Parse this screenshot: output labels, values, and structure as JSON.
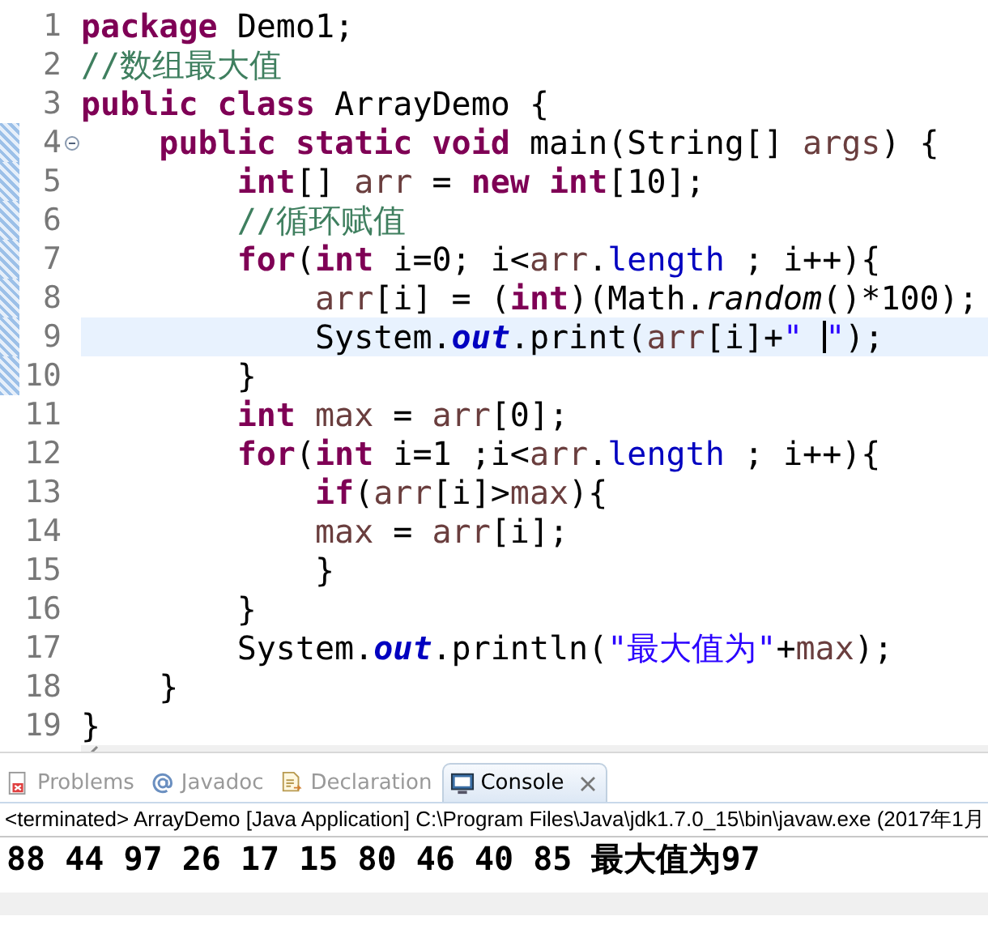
{
  "editor": {
    "lines": [
      {
        "number": "1",
        "selected": false,
        "fold": false,
        "marked": false,
        "tokens": [
          {
            "text": "package ",
            "kind": "keyword"
          },
          {
            "text": "Demo1;",
            "kind": "plain"
          }
        ]
      },
      {
        "number": "2",
        "selected": false,
        "fold": false,
        "marked": false,
        "tokens": [
          {
            "text": "//数组最大值",
            "kind": "comment"
          }
        ]
      },
      {
        "number": "3",
        "selected": false,
        "fold": false,
        "marked": false,
        "tokens": [
          {
            "text": "public class ",
            "kind": "keyword"
          },
          {
            "text": "ArrayDemo {",
            "kind": "plain"
          }
        ]
      },
      {
        "number": "4",
        "selected": false,
        "fold": true,
        "marked": true,
        "tokens": [
          {
            "text": "    public static void ",
            "kind": "keyword"
          },
          {
            "text": "main(String[] ",
            "kind": "plain"
          },
          {
            "text": "args",
            "kind": "variable"
          },
          {
            "text": ") {",
            "kind": "plain"
          }
        ]
      },
      {
        "number": "5",
        "selected": false,
        "fold": false,
        "marked": true,
        "tokens": [
          {
            "text": "        int",
            "kind": "keyword"
          },
          {
            "text": "[] ",
            "kind": "plain"
          },
          {
            "text": "arr",
            "kind": "variable"
          },
          {
            "text": " = ",
            "kind": "plain"
          },
          {
            "text": "new int",
            "kind": "keyword"
          },
          {
            "text": "[10];",
            "kind": "plain"
          }
        ]
      },
      {
        "number": "6",
        "selected": false,
        "fold": false,
        "marked": true,
        "tokens": [
          {
            "text": "        //循环赋值",
            "kind": "comment"
          }
        ]
      },
      {
        "number": "7",
        "selected": false,
        "fold": false,
        "marked": true,
        "tokens": [
          {
            "text": "        for",
            "kind": "keyword"
          },
          {
            "text": "(",
            "kind": "plain"
          },
          {
            "text": "int",
            "kind": "keyword"
          },
          {
            "text": " i=0; i<",
            "kind": "plain"
          },
          {
            "text": "arr",
            "kind": "variable"
          },
          {
            "text": ".",
            "kind": "plain"
          },
          {
            "text": "length",
            "kind": "field"
          },
          {
            "text": " ; i++){",
            "kind": "plain"
          }
        ]
      },
      {
        "number": "8",
        "selected": false,
        "fold": false,
        "marked": true,
        "tokens": [
          {
            "text": "            arr",
            "kind": "variable"
          },
          {
            "text": "[i] = (",
            "kind": "plain"
          },
          {
            "text": "int",
            "kind": "keyword"
          },
          {
            "text": ")(Math.",
            "kind": "plain"
          },
          {
            "text": "random",
            "kind": "static_method"
          },
          {
            "text": "()*100);",
            "kind": "plain"
          }
        ]
      },
      {
        "number": "9",
        "selected": true,
        "fold": false,
        "marked": true,
        "tokens": [
          {
            "text": "            System.",
            "kind": "plain"
          },
          {
            "text": "out",
            "kind": "static_field"
          },
          {
            "text": ".print(",
            "kind": "plain"
          },
          {
            "text": "arr",
            "kind": "variable"
          },
          {
            "text": "[i]+",
            "kind": "plain"
          },
          {
            "text": "\" ",
            "kind": "string",
            "caret_after": true
          },
          {
            "text": "\"",
            "kind": "string"
          },
          {
            "text": ");",
            "kind": "plain"
          }
        ]
      },
      {
        "number": "10",
        "selected": false,
        "fold": false,
        "marked": true,
        "tokens": [
          {
            "text": "        }",
            "kind": "plain"
          }
        ]
      },
      {
        "number": "11",
        "selected": false,
        "fold": false,
        "marked": false,
        "tokens": [
          {
            "text": "        int ",
            "kind": "keyword"
          },
          {
            "text": "max",
            "kind": "variable"
          },
          {
            "text": " = ",
            "kind": "plain"
          },
          {
            "text": "arr",
            "kind": "variable"
          },
          {
            "text": "[0];",
            "kind": "plain"
          }
        ]
      },
      {
        "number": "12",
        "selected": false,
        "fold": false,
        "marked": false,
        "tokens": [
          {
            "text": "        for",
            "kind": "keyword"
          },
          {
            "text": "(",
            "kind": "plain"
          },
          {
            "text": "int",
            "kind": "keyword"
          },
          {
            "text": " i=1 ;i<",
            "kind": "plain"
          },
          {
            "text": "arr",
            "kind": "variable"
          },
          {
            "text": ".",
            "kind": "plain"
          },
          {
            "text": "length",
            "kind": "field"
          },
          {
            "text": " ; i++){",
            "kind": "plain"
          }
        ]
      },
      {
        "number": "13",
        "selected": false,
        "fold": false,
        "marked": false,
        "tokens": [
          {
            "text": "            if",
            "kind": "keyword"
          },
          {
            "text": "(",
            "kind": "plain"
          },
          {
            "text": "arr",
            "kind": "variable"
          },
          {
            "text": "[i]>",
            "kind": "plain"
          },
          {
            "text": "max",
            "kind": "variable"
          },
          {
            "text": "){",
            "kind": "plain"
          }
        ]
      },
      {
        "number": "14",
        "selected": false,
        "fold": false,
        "marked": false,
        "tokens": [
          {
            "text": "            max",
            "kind": "variable"
          },
          {
            "text": " = ",
            "kind": "plain"
          },
          {
            "text": "arr",
            "kind": "variable"
          },
          {
            "text": "[i];",
            "kind": "plain"
          }
        ]
      },
      {
        "number": "15",
        "selected": false,
        "fold": false,
        "marked": false,
        "tokens": [
          {
            "text": "            }",
            "kind": "plain"
          }
        ]
      },
      {
        "number": "16",
        "selected": false,
        "fold": false,
        "marked": false,
        "tokens": [
          {
            "text": "        }",
            "kind": "plain"
          }
        ]
      },
      {
        "number": "17",
        "selected": false,
        "fold": false,
        "marked": false,
        "tokens": [
          {
            "text": "        System.",
            "kind": "plain"
          },
          {
            "text": "out",
            "kind": "static_field"
          },
          {
            "text": ".println(",
            "kind": "plain"
          },
          {
            "text": "\"最大值为\"",
            "kind": "string"
          },
          {
            "text": "+",
            "kind": "plain"
          },
          {
            "text": "max",
            "kind": "variable"
          },
          {
            "text": ");",
            "kind": "plain"
          }
        ]
      },
      {
        "number": "18",
        "selected": false,
        "fold": false,
        "marked": false,
        "tokens": [
          {
            "text": "    }",
            "kind": "plain"
          }
        ]
      },
      {
        "number": "19",
        "selected": false,
        "fold": false,
        "marked": false,
        "tokens": [
          {
            "text": "}",
            "kind": "plain"
          }
        ]
      }
    ]
  },
  "views": {
    "tabs": [
      {
        "label": "Problems",
        "kind": "problems",
        "selected": false
      },
      {
        "label": "Javadoc",
        "kind": "javadoc",
        "selected": false
      },
      {
        "label": "Declaration",
        "kind": "declaration",
        "selected": false
      },
      {
        "label": "Console",
        "kind": "console",
        "selected": true
      }
    ]
  },
  "console": {
    "status": "<terminated> ArrayDemo [Java Application] C:\\Program Files\\Java\\jdk1.7.0_15\\bin\\javaw.exe (2017年1月",
    "output": "88 44 97 26 17 15 80 46 40 85 最大值为97"
  }
}
